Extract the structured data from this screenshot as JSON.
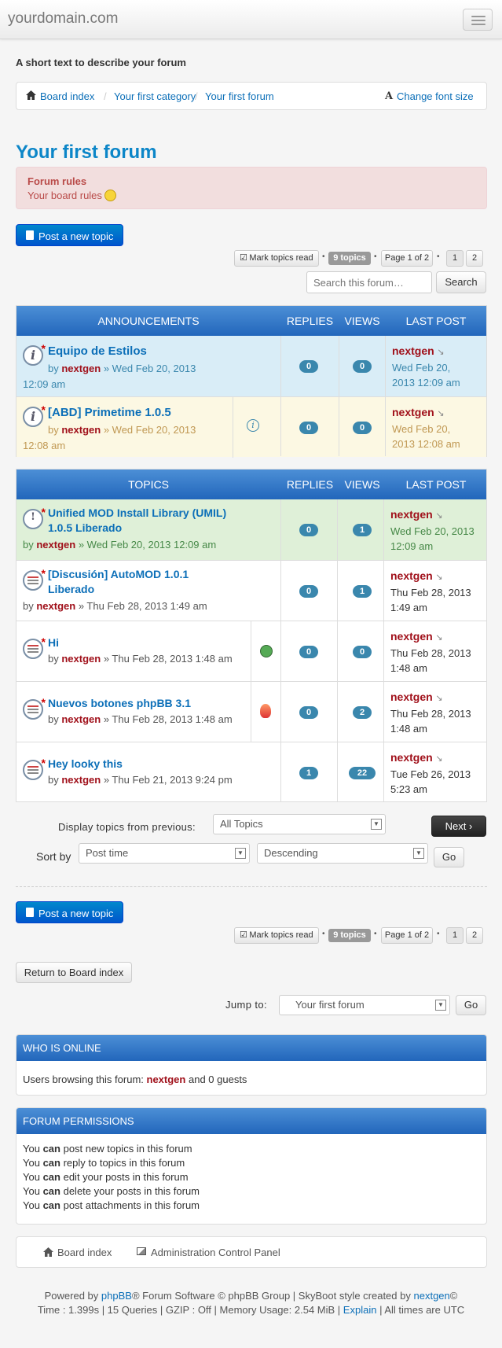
{
  "navbar": {
    "brand": "yourdomain.com"
  },
  "site_description": "A short text to describe your forum",
  "breadcrumbs": {
    "items": [
      "Board index",
      "Your first category",
      "Your first forum"
    ],
    "font_size_label": "Change font size"
  },
  "forum_title": "Your first forum",
  "rules": {
    "title": "Forum rules",
    "text": "Your board rules"
  },
  "actions": {
    "post_new_topic": "Post a new topic",
    "mark_read": "Mark topics read",
    "topic_count": "9 topics",
    "page_of": "Page 1 of 2",
    "pages": [
      "1",
      "2"
    ],
    "search_placeholder": "Search this forum…",
    "search_button": "Search"
  },
  "announcements": {
    "headers": {
      "title": "ANNOUNCEMENTS",
      "replies": "REPLIES",
      "views": "VIEWS",
      "last_post": "LAST POST"
    },
    "rows": [
      {
        "title": "Equipo de Estilos",
        "by": "by",
        "author": "nextgen",
        "date": "» Wed Feb 20, 2013",
        "date2": "12:09 am",
        "replies": "0",
        "views": "0",
        "last_author": "nextgen",
        "last_date1": "Wed Feb 20,",
        "last_date2": "2013 12:09 am"
      },
      {
        "title": "[ABD] Primetime 1.0.5",
        "by": "by",
        "author": "nextgen",
        "date": "» Wed Feb 20, 2013",
        "date2": "12:08 am",
        "replies": "0",
        "views": "0",
        "last_author": "nextgen",
        "last_date1": "Wed Feb 20,",
        "last_date2": "2013 12:08 am"
      }
    ]
  },
  "topics": {
    "headers": {
      "title": "TOPICS",
      "replies": "REPLIES",
      "views": "VIEWS",
      "last_post": "LAST POST"
    },
    "rows": [
      {
        "title1": "Unified MOD Install Library (UMIL)",
        "title2": "1.0.5 Liberado",
        "by": "by",
        "author": "nextgen",
        "date": "» Wed Feb 20, 2013 12:09 am",
        "replies": "0",
        "views": "1",
        "last_author": "nextgen",
        "last_date1": "Wed Feb 20, 2013",
        "last_date2": "12:09 am"
      },
      {
        "title1": "[Discusión] AutoMOD 1.0.1",
        "title2": "Liberado",
        "by": "by",
        "author": "nextgen",
        "date": "» Thu Feb 28, 2013 1:49 am",
        "replies": "0",
        "views": "1",
        "last_author": "nextgen",
        "last_date1": "Thu Feb 28, 2013",
        "last_date2": "1:49 am"
      },
      {
        "title1": "Hi",
        "by": "by",
        "author": "nextgen",
        "date": "» Thu Feb 28, 2013 1:48 am",
        "replies": "0",
        "views": "0",
        "last_author": "nextgen",
        "last_date1": "Thu Feb 28, 2013",
        "last_date2": "1:48 am"
      },
      {
        "title1": "Nuevos botones phpBB 3.1",
        "by": "by",
        "author": "nextgen",
        "date": "» Thu Feb 28, 2013 1:48 am",
        "replies": "0",
        "views": "2",
        "last_author": "nextgen",
        "last_date1": "Thu Feb 28, 2013",
        "last_date2": "1:48 am"
      },
      {
        "title1": "Hey looky this",
        "by": "by",
        "author": "nextgen",
        "date": "» Thu Feb 21, 2013 9:24 pm",
        "replies": "1",
        "views": "22",
        "last_author": "nextgen",
        "last_date1": "Tue Feb 26, 2013",
        "last_date2": "5:23 am"
      }
    ]
  },
  "sort": {
    "display_label": "Display topics from previous:",
    "display_value": "All Topics",
    "next": "Next",
    "sort_label": "Sort by",
    "sort_value": "Post time",
    "order_value": "Descending",
    "go": "Go"
  },
  "bottom": {
    "return": "Return to Board index",
    "jump_label": "Jump to:",
    "jump_value": "Your first forum",
    "go": "Go"
  },
  "online": {
    "title": "WHO IS ONLINE",
    "text": "Users browsing this forum:",
    "user": "nextgen",
    "guests": "and 0 guests"
  },
  "permissions": {
    "title": "FORUM PERMISSIONS",
    "you": "You",
    "can": "can",
    "lines": [
      "post new topics in this forum",
      "reply to topics in this forum",
      "edit your posts in this forum",
      "delete your posts in this forum",
      "post attachments in this forum"
    ]
  },
  "footer_nav": {
    "board_index": "Board index",
    "acp": "Administration Control Panel"
  },
  "credits": {
    "powered": "Powered by",
    "phpbb": "phpBB",
    "mid": "® Forum Software © phpBB Group | SkyBoot style created by",
    "author": "nextgen",
    "copy": "©",
    "stats": "Time : 1.399s | 15 Queries | GZIP : Off | Memory Usage: 2.54 MiB |",
    "explain": "Explain",
    "tz": "| All times are UTC"
  },
  "colors": {
    "primary": "#0055cc",
    "header_blue": "#2266bb",
    "author_red": "#a0101a",
    "announce_bg": "#d9edf7",
    "global_bg": "#fcf8e3",
    "sticky_bg": "#dff0d8",
    "rules_bg": "#f2dede"
  }
}
